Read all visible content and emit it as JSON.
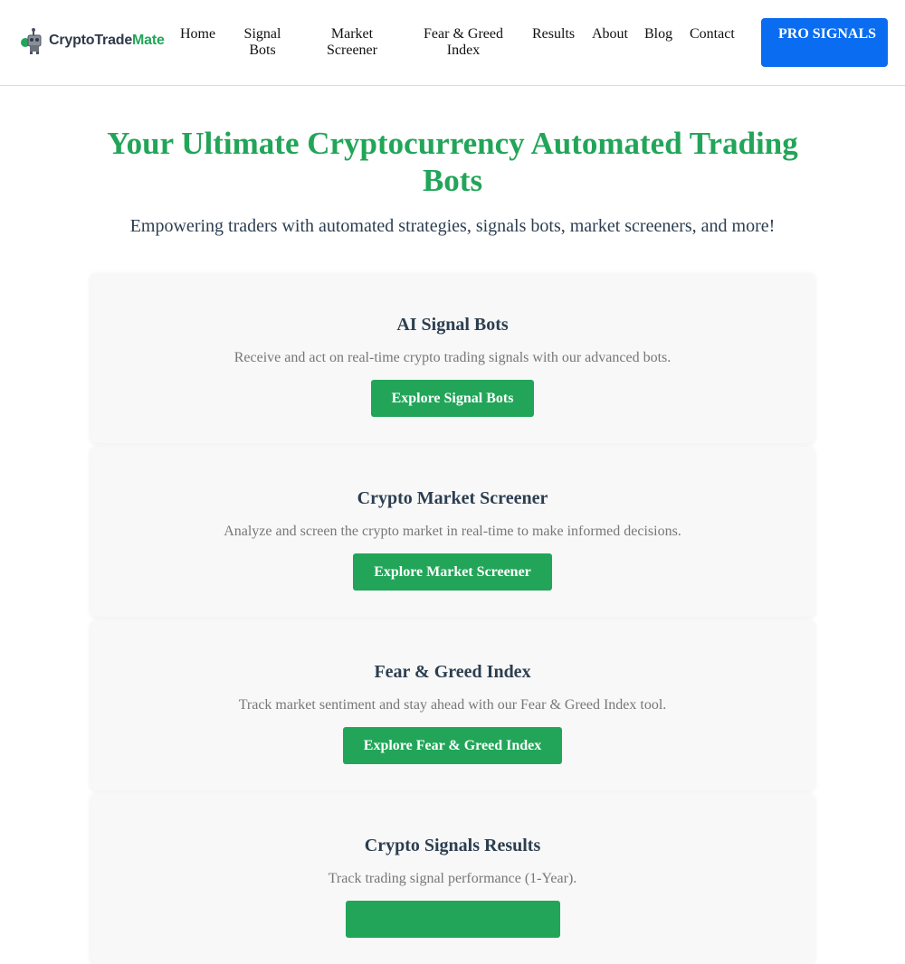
{
  "header": {
    "logo": {
      "icon": "robot-icon",
      "text_main": "CryptoTrade",
      "text_accent": "Mate"
    },
    "nav": [
      {
        "label": "Home"
      },
      {
        "label": "Signal Bots"
      },
      {
        "label": "Market Screener"
      },
      {
        "label": "Fear & Greed Index"
      },
      {
        "label": "Results"
      },
      {
        "label": "About"
      },
      {
        "label": "Blog"
      },
      {
        "label": "Contact"
      }
    ],
    "pro_button": "PRO SIGNALS"
  },
  "hero": {
    "title": "Your Ultimate Cryptocurrency Automated Trading Bots",
    "subtitle": "Empowering traders with automated strategies, signals bots, market screeners, and more!"
  },
  "cards": [
    {
      "glyph": "",
      "title": "AI Signal Bots",
      "desc": "Receive and act on real-time crypto trading signals with our advanced bots.",
      "button": "Explore Signal Bots"
    },
    {
      "glyph": "",
      "title": "Crypto Market Screener",
      "desc": "Analyze and screen the crypto market in real-time to make informed decisions.",
      "button": "Explore Market Screener"
    },
    {
      "glyph": "",
      "title": "Fear & Greed Index",
      "desc": "Track market sentiment and stay ahead with our Fear & Greed Index tool.",
      "button": "Explore Fear & Greed Index"
    },
    {
      "glyph": "",
      "title": "Crypto Signals Results",
      "desc": "Track trading signal performance (1-Year).",
      "button": ""
    }
  ],
  "colors": {
    "accent_green": "#22a559",
    "pro_blue": "#0a6cf0",
    "card_bg": "#f8f8f8"
  }
}
